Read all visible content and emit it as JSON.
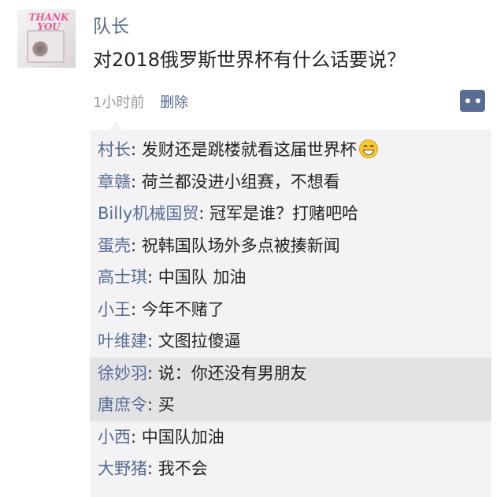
{
  "post": {
    "avatar_logo_text": "THANK YOU",
    "username": "队长",
    "text": "对2018俄罗斯世界杯有什么话要说？",
    "time": "1小时前",
    "delete_label": "删除",
    "more_icon": "more-dots-icon"
  },
  "comments": [
    {
      "author": "村长",
      "sep": ": ",
      "text": "发财还是跳楼就看这届世界杯",
      "emoji": "grinning-face-icon"
    },
    {
      "author": "章赣",
      "sep": ": ",
      "text": "荷兰都没进小组赛，不想看"
    },
    {
      "author": "Billy机械国贸",
      "sep": ": ",
      "text": "冠军是谁？打赌吧哈"
    },
    {
      "author": "蛋壳",
      "sep": ": ",
      "text": "祝韩国队场外多点被揍新闻"
    },
    {
      "author": "高士琪",
      "sep": ": ",
      "text": "中国队 加油"
    },
    {
      "author": "小王",
      "sep": ": ",
      "text": "今年不赌了"
    },
    {
      "author": "叶维建",
      "sep": ": ",
      "text": "文图拉傻逼"
    },
    {
      "author": "徐妙羽",
      "sep": ": ",
      "text": "说：你还没有男朋友"
    },
    {
      "author": "唐庶令",
      "sep": ": ",
      "text": "买"
    },
    {
      "author": "小西",
      "sep": ": ",
      "text": "中国队加油"
    },
    {
      "author": "大野猪",
      "sep": ": ",
      "text": "我不会"
    }
  ],
  "colors": {
    "link": "#586b92",
    "text": "#222222",
    "time": "#9a9a9a",
    "comment_bg": "#f3f3f5",
    "highlight_bg": "#e3e3e6",
    "more_button_bg": "#5a6c91"
  }
}
